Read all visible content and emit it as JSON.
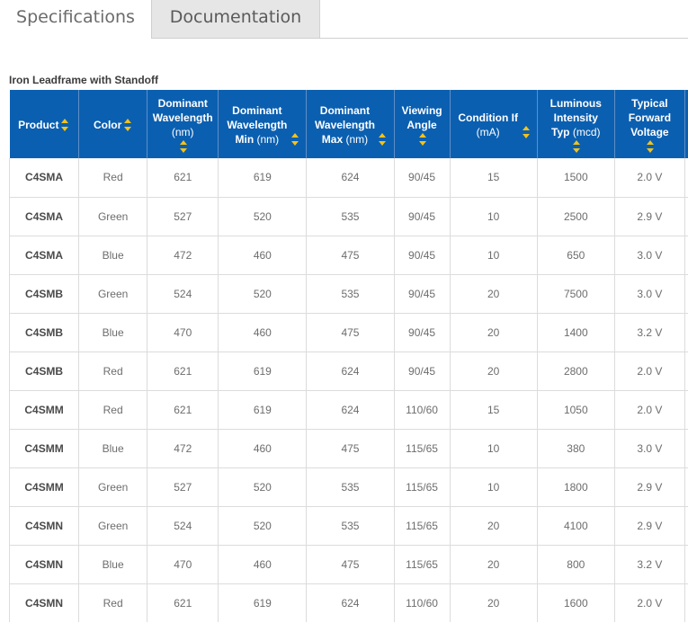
{
  "tabs": [
    {
      "label": "Specifications",
      "active": true
    },
    {
      "label": "Documentation",
      "active": false
    }
  ],
  "section_title": "Iron Leadframe with Standoff",
  "table": {
    "headers": [
      {
        "label": "Product",
        "unit": ""
      },
      {
        "label": "Color",
        "unit": ""
      },
      {
        "label": "Dominant Wavelength",
        "unit": "(nm)"
      },
      {
        "label": "Dominant Wavelength Min",
        "unit": "(nm)"
      },
      {
        "label": "Dominant Wavelength Max",
        "unit": "(nm)"
      },
      {
        "label": "Viewing Angle",
        "unit": ""
      },
      {
        "label": "Condition If",
        "unit": "(mA)"
      },
      {
        "label": "Luminous Intensity Typ",
        "unit": "(mcd)"
      },
      {
        "label": "Typical Forward Voltage",
        "unit": ""
      }
    ],
    "rows": [
      [
        "C4SMA",
        "Red",
        "621",
        "619",
        "624",
        "90/45",
        "15",
        "1500",
        "2.0 V"
      ],
      [
        "C4SMA",
        "Green",
        "527",
        "520",
        "535",
        "90/45",
        "10",
        "2500",
        "2.9 V"
      ],
      [
        "C4SMA",
        "Blue",
        "472",
        "460",
        "475",
        "90/45",
        "10",
        "650",
        "3.0 V"
      ],
      [
        "C4SMB",
        "Green",
        "524",
        "520",
        "535",
        "90/45",
        "20",
        "7500",
        "3.0 V"
      ],
      [
        "C4SMB",
        "Blue",
        "470",
        "460",
        "475",
        "90/45",
        "20",
        "1400",
        "3.2 V"
      ],
      [
        "C4SMB",
        "Red",
        "621",
        "619",
        "624",
        "90/45",
        "20",
        "2800",
        "2.0 V"
      ],
      [
        "C4SMM",
        "Red",
        "621",
        "619",
        "624",
        "110/60",
        "15",
        "1050",
        "2.0 V"
      ],
      [
        "C4SMM",
        "Blue",
        "472",
        "460",
        "475",
        "115/65",
        "10",
        "380",
        "3.0 V"
      ],
      [
        "C4SMM",
        "Green",
        "527",
        "520",
        "535",
        "115/65",
        "10",
        "1800",
        "2.9 V"
      ],
      [
        "C4SMN",
        "Green",
        "524",
        "520",
        "535",
        "115/65",
        "20",
        "4100",
        "2.9 V"
      ],
      [
        "C4SMN",
        "Blue",
        "470",
        "460",
        "475",
        "115/65",
        "20",
        "800",
        "3.2 V"
      ],
      [
        "C4SMN",
        "Red",
        "621",
        "619",
        "624",
        "110/60",
        "20",
        "1600",
        "2.0 V"
      ]
    ]
  },
  "colors": {
    "header_bg": "#0b5fb0",
    "sort_icon": "#f3c21b"
  }
}
